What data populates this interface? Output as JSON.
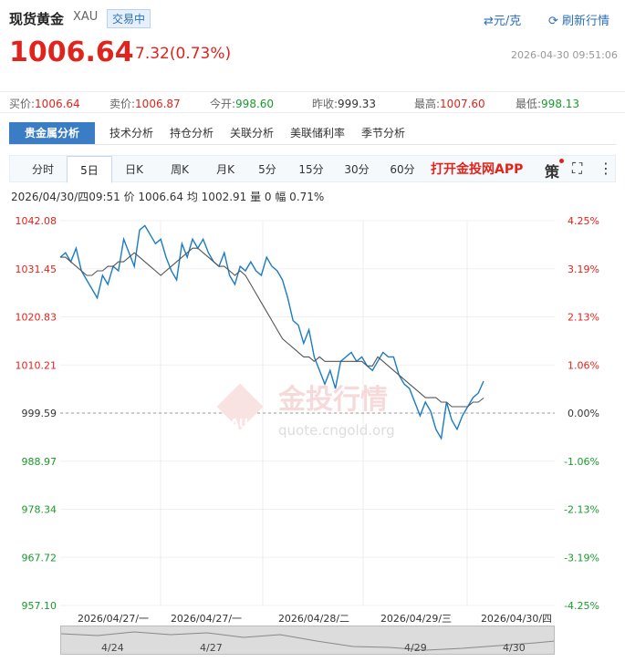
{
  "header": {
    "title": "现货黄金",
    "symbol": "XAU",
    "status": "交易中",
    "unit_button": "⇄元/克",
    "refresh_button": "刷新行情",
    "price": "1006.64",
    "change": "7.32(0.73%)",
    "timestamp": "2026-04-30 09:51:06"
  },
  "stats": [
    {
      "label": "买价:",
      "value": "1006.64",
      "color": "#e0231c"
    },
    {
      "label": "卖价:",
      "value": "1006.87",
      "color": "#e0231c"
    },
    {
      "label": "今开:",
      "value": "998.60",
      "color": "#1a9a2c"
    },
    {
      "label": "昨收:",
      "value": "999.33",
      "color": "#333333"
    },
    {
      "label": "最高:",
      "value": "1007.60",
      "color": "#e0231c"
    },
    {
      "label": "最低:",
      "value": "998.13",
      "color": "#1a9a2c"
    }
  ],
  "analysis_tabs": [
    "贵金属分析",
    "技术分析",
    "持仓分析",
    "关联分析",
    "美联储利率",
    "季节分析"
  ],
  "periods": [
    "分时",
    "5日",
    "日K",
    "周K",
    "月K",
    "5分",
    "15分",
    "30分",
    "60分"
  ],
  "active_period": "5日",
  "app_link": "打开金投网APP",
  "tools": {
    "strategy": "策",
    "fullscreen_icon": "fullscreen-icon",
    "more_icon": "more-icon"
  },
  "info_line": "2026/04/30/四09:51  价 1006.64  均 1002.91  量 0  幅 0.71%",
  "watermark": {
    "brand": "金投行情",
    "url": "quote.cngold.org",
    "logo_text": "AU"
  },
  "navigator_labels": [
    "4/24",
    "4/27",
    "4/29",
    "4/30"
  ],
  "colors": {
    "up": "#e0231c",
    "down": "#1a9a2c",
    "price_line": "#1a7bc2",
    "avg_line": "#555555",
    "accent": "#3b7dc4"
  },
  "chart_data": {
    "type": "line",
    "title": "",
    "ylim": [
      957.1,
      1042.08
    ],
    "reference": 999.59,
    "left_ticks": [
      "1042.08",
      "1031.45",
      "1020.83",
      "1010.21",
      "999.59",
      "988.97",
      "978.34",
      "967.72",
      "957.10"
    ],
    "right_ticks": [
      "4.25%",
      "3.19%",
      "2.13%",
      "1.06%",
      "0.00%",
      "-1.06%",
      "-2.13%",
      "-3.19%",
      "-4.25%"
    ],
    "x_labels": [
      "2026/04/27/一",
      "2026/04/27/一",
      "2026/04/28/二",
      "2026/04/29/三",
      "2026/04/30/四"
    ],
    "series": [
      {
        "name": "价",
        "values": [
          1034,
          1035,
          1033,
          1036,
          1031,
          1029,
          1027,
          1025,
          1030,
          1028,
          1032,
          1031,
          1038,
          1035,
          1032,
          1040,
          1041,
          1039,
          1037,
          1038,
          1034,
          1031,
          1029,
          1037,
          1034,
          1038,
          1036,
          1038,
          1035,
          1033,
          1032,
          1035,
          1030,
          1028,
          1032,
          1031,
          1033,
          1031,
          1030,
          1034,
          1032,
          1031,
          1029,
          1025,
          1020,
          1019,
          1015,
          1018,
          1012,
          1009,
          1006,
          1009,
          1005,
          1011,
          1012,
          1013,
          1011,
          1012,
          1010,
          1009,
          1011,
          1013,
          1012,
          1012,
          1008,
          1006,
          1005,
          1002,
          999,
          1002,
          1000,
          996,
          994,
          1002,
          998,
          996,
          999,
          1001,
          1003,
          1004,
          1006.64
        ]
      },
      {
        "name": "均",
        "values": [
          1034,
          1034,
          1033,
          1032,
          1031,
          1030,
          1030,
          1031,
          1031,
          1032,
          1032,
          1033,
          1033,
          1034,
          1035,
          1034,
          1033,
          1032,
          1031,
          1030,
          1031,
          1032,
          1033,
          1034,
          1035,
          1036,
          1036,
          1035,
          1034,
          1033,
          1032,
          1032,
          1031,
          1030,
          1031,
          1030,
          1028,
          1026,
          1024,
          1022,
          1020,
          1018,
          1016,
          1015,
          1014,
          1013,
          1012,
          1012,
          1011,
          1012,
          1011,
          1011,
          1011,
          1011,
          1011,
          1011,
          1011,
          1011,
          1010,
          1010,
          1012,
          1011,
          1010,
          1009,
          1008,
          1007,
          1006,
          1005,
          1004,
          1003,
          1003,
          1003,
          1002,
          1002,
          1001,
          1001,
          1001,
          1001,
          1002,
          1002,
          1002.91
        ]
      }
    ]
  }
}
